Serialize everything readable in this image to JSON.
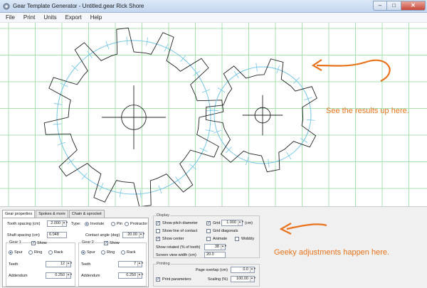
{
  "window": {
    "title": "Gear Template Generator - Untitled.gear    Rick Shore",
    "minimize": "–",
    "maximize": "□",
    "close": "✕"
  },
  "menu": [
    "File",
    "Print",
    "Units",
    "Export",
    "Help"
  ],
  "annotations": {
    "top": "See the results up here.",
    "bottom": "Geeky adjustments happen here.",
    "color": "#e8731c"
  },
  "colors": {
    "grid": "#a8e0b0",
    "pitch": "#77c6e8",
    "gear": "#222222",
    "arrow": "#e8731c"
  },
  "tabs": [
    "Gear properties",
    "Spokes & more",
    "Chain & sprocket"
  ],
  "gear_props": {
    "tooth_spacing_label": "Tooth spacing (cm)",
    "tooth_spacing": "2.000",
    "type_label": "Type:",
    "type_options": [
      "Involute",
      "Pin",
      "Protractor"
    ],
    "shaft_spacing_label": "Shaft spacing (cm)",
    "shaft_spacing": "6.048",
    "contact_angle_label": "Contact angle (deg)",
    "contact_angle": "20.00",
    "gear1": {
      "title": "Gear 1",
      "show_label": "Show",
      "options": [
        "Spur",
        "Ring",
        "Rack"
      ],
      "teeth_label": "Teeth",
      "teeth": "12",
      "addendum_label": "Addendum",
      "addendum": "0.250"
    },
    "gear2": {
      "title": "Gear 2",
      "show_label": "Show",
      "options": [
        "Spur",
        "Ring",
        "Rack"
      ],
      "teeth_label": "Teeth",
      "teeth": "7",
      "addendum_label": "Addendum",
      "addendum": "0.250"
    }
  },
  "display": {
    "title": "Display",
    "show_pitch_diameter": "Show pitch diameter",
    "show_line_of_contact": "Show line of contact",
    "show_center": "Show center",
    "grid_label": "Grid",
    "grid_value": "1.000",
    "grid_unit": "(cm)",
    "grid_diagonals": "Grid diagonals",
    "animate": "Animate",
    "wobbly": "Wobbly",
    "show_rotated_label": "Show rotated (% of tooth)",
    "show_rotated": "38",
    "screen_view_label": "Screen view width (cm)",
    "screen_view": "20.0"
  },
  "printing": {
    "title": "Printing",
    "page_overlap_label": "Page overlap (cm)",
    "page_overlap": "0.0",
    "print_parameters": "Print parameters",
    "scaling_label": "Scaling (%)",
    "scaling": "100.00"
  }
}
